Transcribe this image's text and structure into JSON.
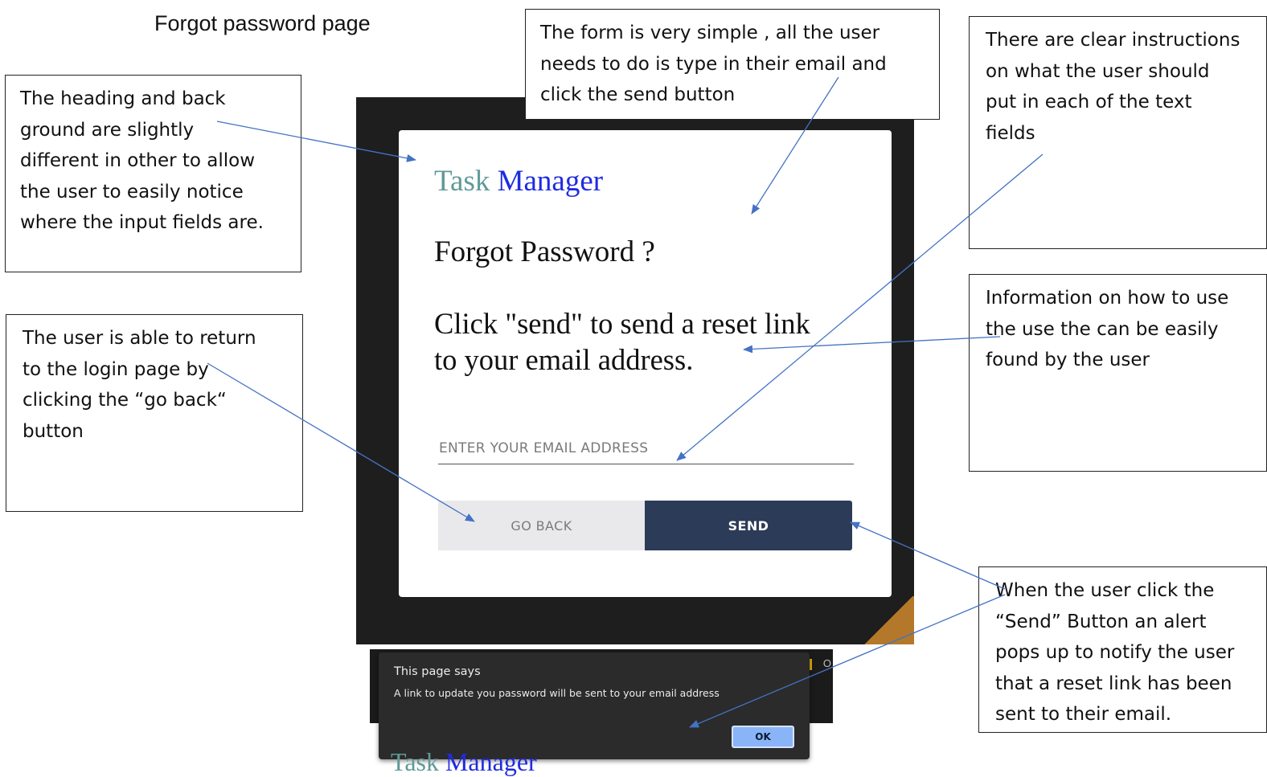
{
  "page_heading": "Forgot password page",
  "app": {
    "brand_part1": "Task",
    "brand_part2": "Manager",
    "form_title": "Forgot Password ?",
    "instruction_line1": "Click \"send\" to send a reset link",
    "instruction_line2": "to your email address.",
    "email_placeholder": "ENTER YOUR EMAIL ADDRESS",
    "back_button": "GO BACK",
    "send_button": "SEND"
  },
  "alert": {
    "title": "This page says",
    "message": "A link to update you password will be sent to your email address",
    "ok_button": "OK",
    "background_fragment": "O"
  },
  "annotations": {
    "heading_background": [
      "The heading and back",
      "ground are slightly",
      "different in other to allow",
      "the user to easily notice",
      "where the input fields are."
    ],
    "form_simple": [
      "The form is very simple , all the user",
      "needs to do is type in their email and",
      "click the send button"
    ],
    "instructions": [
      "There are clear instructions",
      "on what the user should",
      "put in each of the text",
      "fields"
    ],
    "go_back": [
      "The user is able to return",
      "to the login page by",
      "clicking the “go back“",
      "button"
    ],
    "information": [
      "Information on how to use",
      "the use the can be easily",
      "found by the user"
    ],
    "send_alert": [
      "When the user click the",
      "“Send” Button an alert",
      "pops up to notify the user",
      "that a reset link has been",
      "sent to their email."
    ]
  },
  "colors": {
    "panel": "#1e1e1f",
    "brand_task": "#5f9a98",
    "brand_manager": "#1f2be0",
    "send_button": "#2c3b57",
    "back_button": "#e9e9ec",
    "arrow": "#4472c4",
    "alert_ok": "#8ab4f8"
  }
}
